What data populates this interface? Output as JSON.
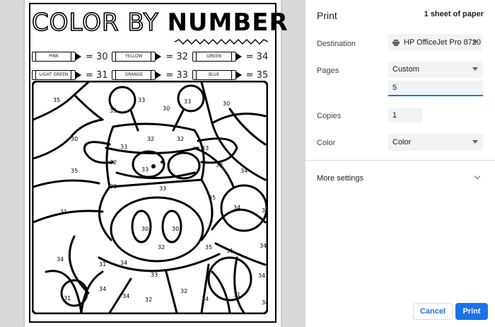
{
  "preview": {
    "title_part1": "COLOR BY ",
    "title_part2": "NUMBER",
    "legend": [
      {
        "crayon": "PINK",
        "value": "= 30"
      },
      {
        "crayon": "YELLOW",
        "value": "= 32"
      },
      {
        "crayon": "GREEN",
        "value": "= 34"
      },
      {
        "crayon": "LIGHT GREEN",
        "value": "= 31"
      },
      {
        "crayon": "ORANGE",
        "value": "= 33"
      },
      {
        "crayon": "BLUE",
        "value": "= 35"
      }
    ]
  },
  "panel": {
    "title": "Print",
    "sheets": "1 sheet of paper",
    "destination_label": "Destination",
    "destination_value": "HP OfficeJet Pro 8720",
    "pages_label": "Pages",
    "pages_value": "Custom",
    "pages_input": "5",
    "copies_label": "Copies",
    "copies_value": "1",
    "color_label": "Color",
    "color_value": "Color",
    "more_settings": "More settings",
    "cancel": "Cancel",
    "print": "Print"
  },
  "colors": {
    "accent": "#1a73e8",
    "field_bg": "#f1f3f4",
    "preview_bg": "#d7d8da"
  }
}
